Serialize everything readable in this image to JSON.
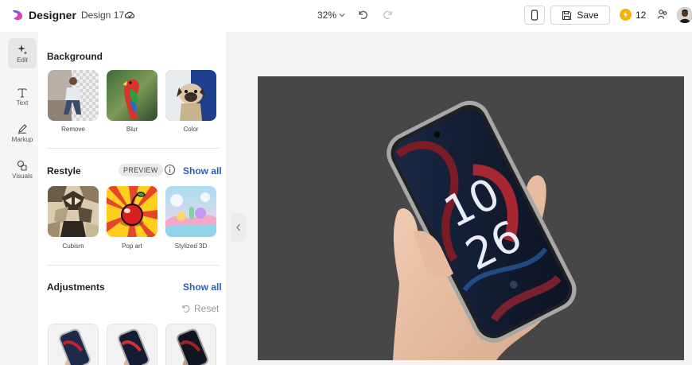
{
  "header": {
    "app_name": "Designer",
    "document_name": "Design 17",
    "zoom": "32%",
    "save_label": "Save",
    "credits": "12"
  },
  "rail": {
    "items": [
      {
        "label": "Edit",
        "icon": "sparkle-icon",
        "active": true
      },
      {
        "label": "Text",
        "icon": "text-icon",
        "active": false
      },
      {
        "label": "Markup",
        "icon": "pen-icon",
        "active": false
      },
      {
        "label": "Visuals",
        "icon": "shapes-icon",
        "active": false
      }
    ]
  },
  "panel": {
    "background": {
      "title": "Background",
      "options": [
        {
          "label": "Remove"
        },
        {
          "label": "Blur"
        },
        {
          "label": "Color"
        }
      ]
    },
    "restyle": {
      "title": "Restyle",
      "badge": "PREVIEW",
      "show_all": "Show all",
      "options": [
        {
          "label": "Cubism"
        },
        {
          "label": "Pop art"
        },
        {
          "label": "Stylized 3D"
        }
      ]
    },
    "adjustments": {
      "title": "Adjustments",
      "show_all": "Show all",
      "reset": "Reset"
    }
  },
  "canvas": {
    "phone_hour": "10",
    "phone_minute": "26",
    "background_color": "#474747"
  }
}
